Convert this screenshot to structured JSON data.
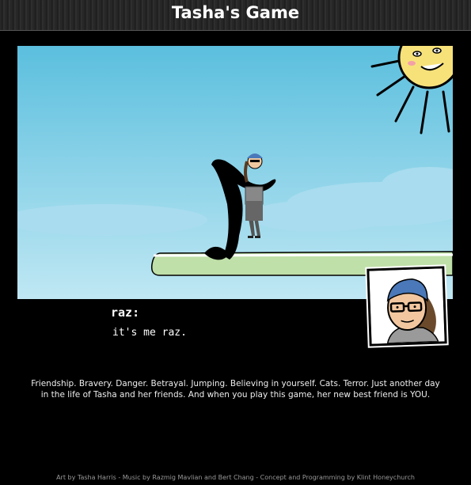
{
  "header": {
    "title": "Tasha's Game"
  },
  "dialog": {
    "speaker": "raz:",
    "text": "it's me raz."
  },
  "description": {
    "line1": "Friendship. Bravery. Danger. Betrayal. Jumping. Believing in yourself. Cats. Terror. Just another day",
    "line2": "in the life of Tasha and her friends. And when you play this game, her new best friend is YOU."
  },
  "credits": {
    "text": "Art by Tasha Harris - Music by Razmig Mavlian and Bert Chang - Concept and Programming by Klint Honeychurch"
  },
  "colors": {
    "sky_top": "#5bbfde",
    "sky_bottom": "#bfe7f3",
    "sun": "#f7e27a",
    "grass": "#bfe0a8",
    "background": "#000000"
  }
}
